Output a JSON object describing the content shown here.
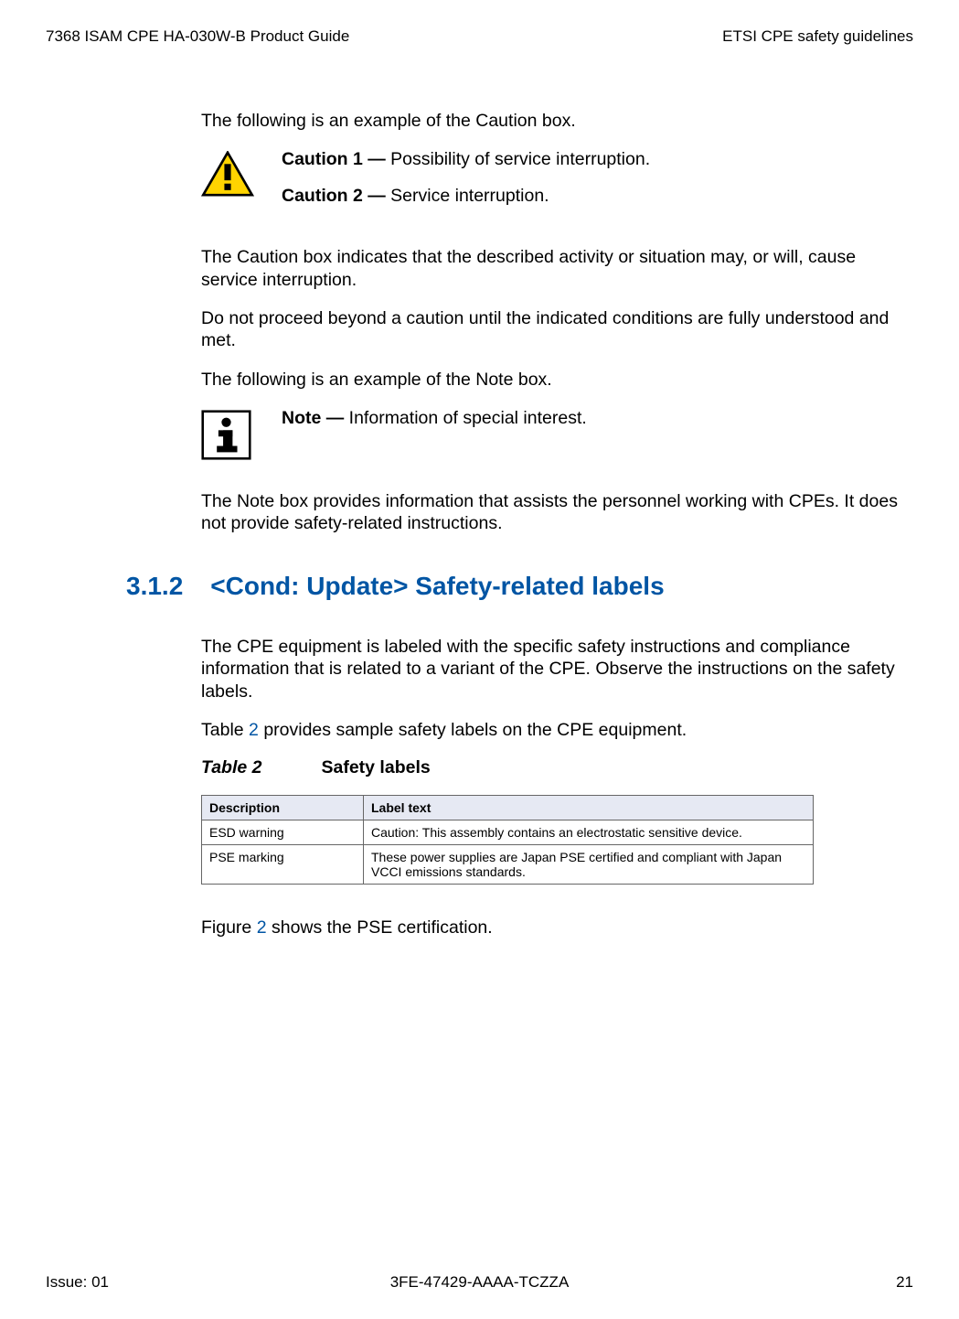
{
  "header": {
    "left": "7368 ISAM CPE HA-030W-B Product Guide",
    "right": "ETSI CPE safety guidelines"
  },
  "body": {
    "p1": "The following is an example of the Caution box.",
    "caution1_label": "Caution 1 — ",
    "caution1_text": "Possibility of service interruption.",
    "caution2_label": "Caution 2 — ",
    "caution2_text": "Service interruption.",
    "p2": "The Caution box indicates that the described activity or situation may, or will, cause service interruption.",
    "p3": "Do not proceed beyond a caution until the indicated conditions are fully understood and met.",
    "p4": "The following is an example of the Note box.",
    "note_label": "Note — ",
    "note_text": "Information of special interest.",
    "p5": "The Note box provides information that assists the personnel working with CPEs. It does not provide safety-related instructions."
  },
  "section": {
    "num": "3.1.2",
    "title": "<Cond: Update> Safety-related labels",
    "p1": "The CPE equipment is labeled with the specific safety instructions and compliance information that is related to a variant of the CPE. Observe the instructions on the safety labels.",
    "p2a": "Table ",
    "p2ref": "2",
    "p2b": " provides sample safety labels on the CPE equipment.",
    "table_label": "Table 2",
    "table_title": "Safety labels",
    "th1": "Description",
    "th2": "Label text",
    "r1c1": "ESD warning",
    "r1c2": "Caution: This assembly contains an electrostatic sensitive device.",
    "r2c1": "PSE marking",
    "r2c2": "These power supplies are Japan PSE certified and compliant with Japan VCCI emissions standards.",
    "p3a": "Figure ",
    "p3ref": "2",
    "p3b": " shows the PSE certification."
  },
  "footer": {
    "left": "Issue: 01",
    "center": "3FE-47429-AAAA-TCZZA",
    "right": "21"
  }
}
